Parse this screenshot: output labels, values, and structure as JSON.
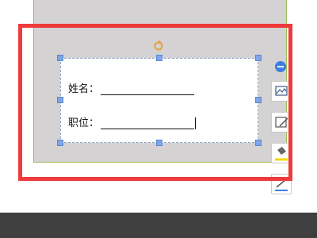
{
  "textbox": {
    "name_label": "姓名：",
    "position_label": "职位："
  },
  "icons": {
    "rotate": "rotate-icon",
    "collapse": "collapse-minus-icon",
    "layout": "layout-options-icon",
    "outline": "shape-outline-icon",
    "fill": "fill-bucket-icon",
    "line_color": "line-color-icon"
  },
  "colors": {
    "accent": "#3f7ee0",
    "annotation_frame": "#ee3b3b",
    "page_background": "#d4d2d2",
    "handle": "#7fa6e8"
  }
}
